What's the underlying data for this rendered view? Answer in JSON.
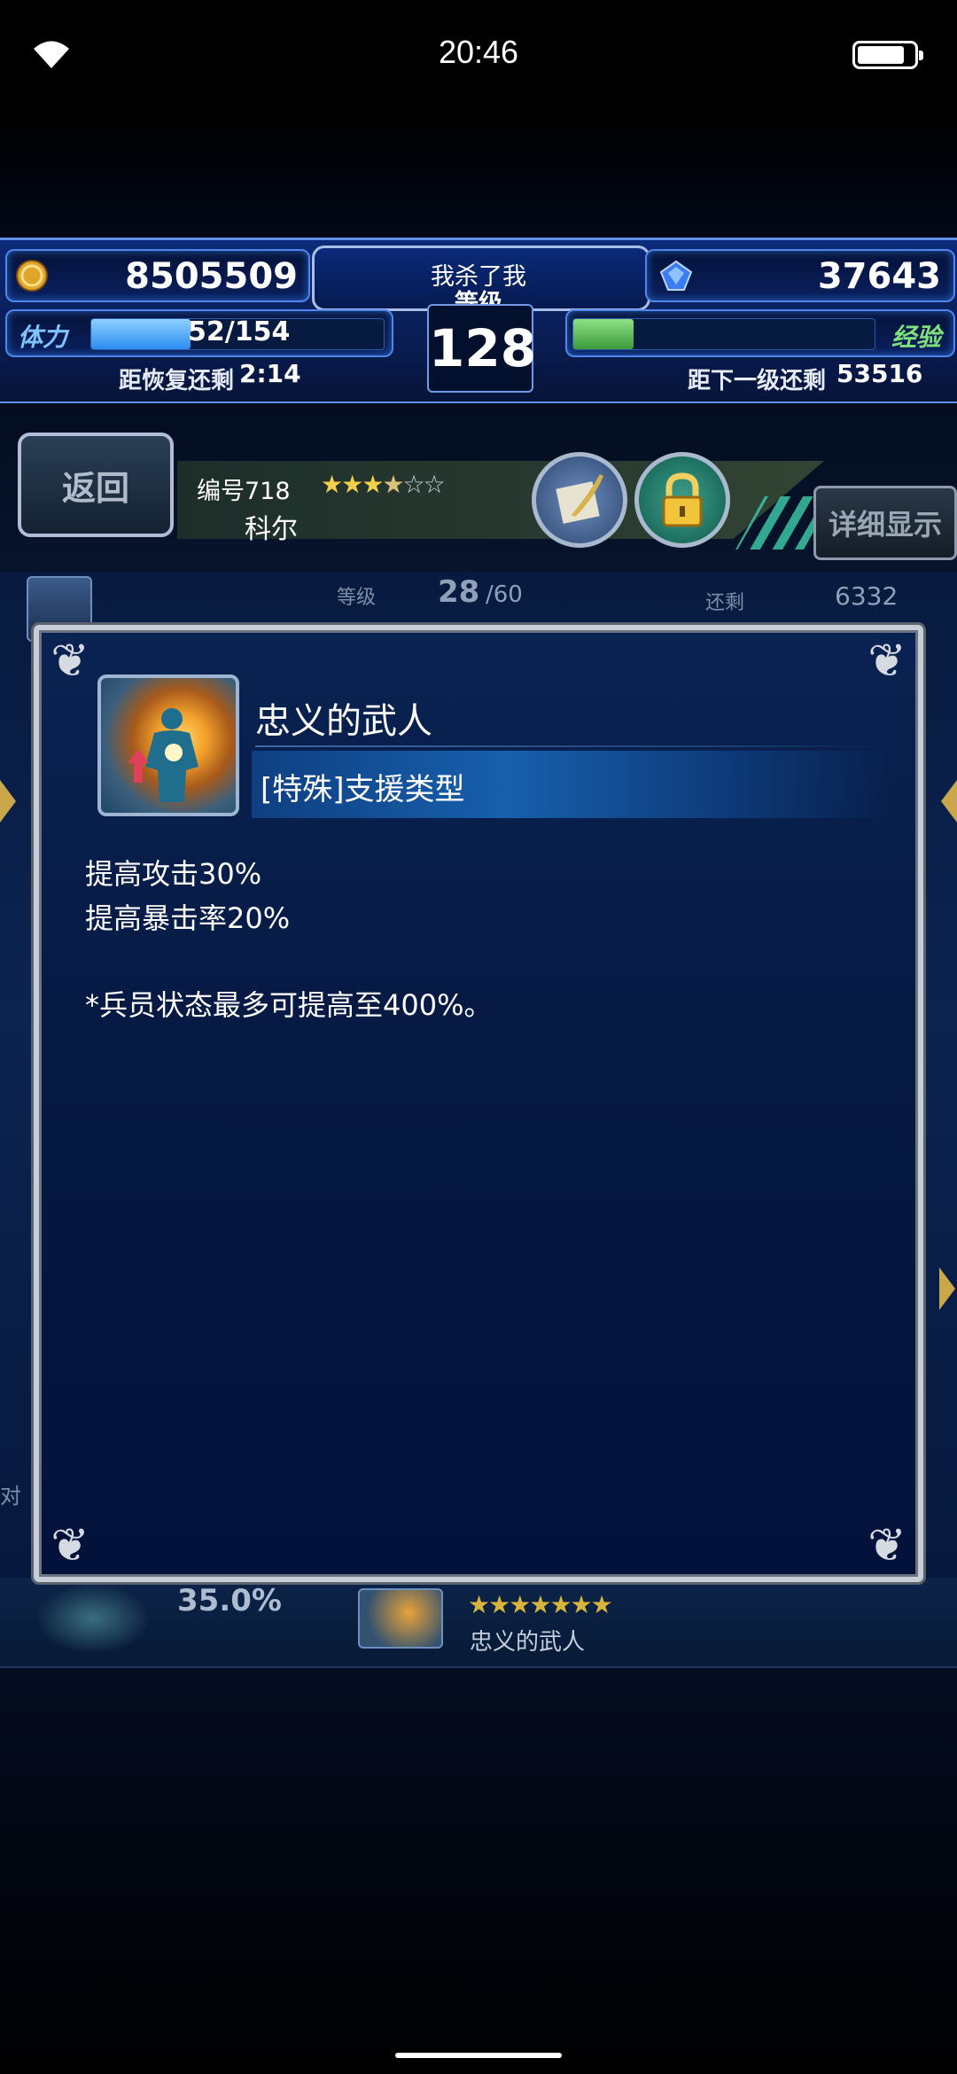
{
  "status_bar": {
    "time": "20:46",
    "wifi_icon": "wifi-icon",
    "battery_icon": "battery-icon"
  },
  "hud": {
    "gold": "8505509",
    "gems": "37643",
    "player_name": "我杀了我",
    "level_label": "等级",
    "level": "128",
    "stamina_label": "体力",
    "stamina_value": "52/154",
    "stamina_fill": 0.34,
    "recover_label": "距恢复还剩",
    "recover_time": "2:14",
    "exp_label": "经验",
    "exp_fill": 0.2,
    "next_label": "距下一级还剩",
    "next_value": "53516",
    "colors": {
      "hud_blue": "#0c2a78",
      "exp_green": "#4cb84a",
      "stamina_blue": "#3aa0ff"
    }
  },
  "character": {
    "back_label": "返回",
    "number": "编号718",
    "name": "科尔",
    "rarity": 3.5,
    "rarity_max": 6,
    "detail_label": "详细显示",
    "quill_icon": "quill-icon",
    "lock_icon": "lock-icon"
  },
  "background": {
    "level_label": "等级",
    "level_value": "28",
    "level_max": "/60",
    "remaining_label": "还剩",
    "remaining_value": "6332",
    "side_text": "对",
    "percent": "35.0%",
    "bottom_skill_name": "忠义的武人",
    "bottom_stars": 7
  },
  "modal": {
    "skill_name": "忠义的武人",
    "skill_type": "[特殊]支援类型",
    "skill_icon": "buff-body-icon",
    "lines": [
      "提高攻击30%",
      "提高暴击率20%"
    ],
    "note": "*兵员状态最多可提高至400%。"
  }
}
